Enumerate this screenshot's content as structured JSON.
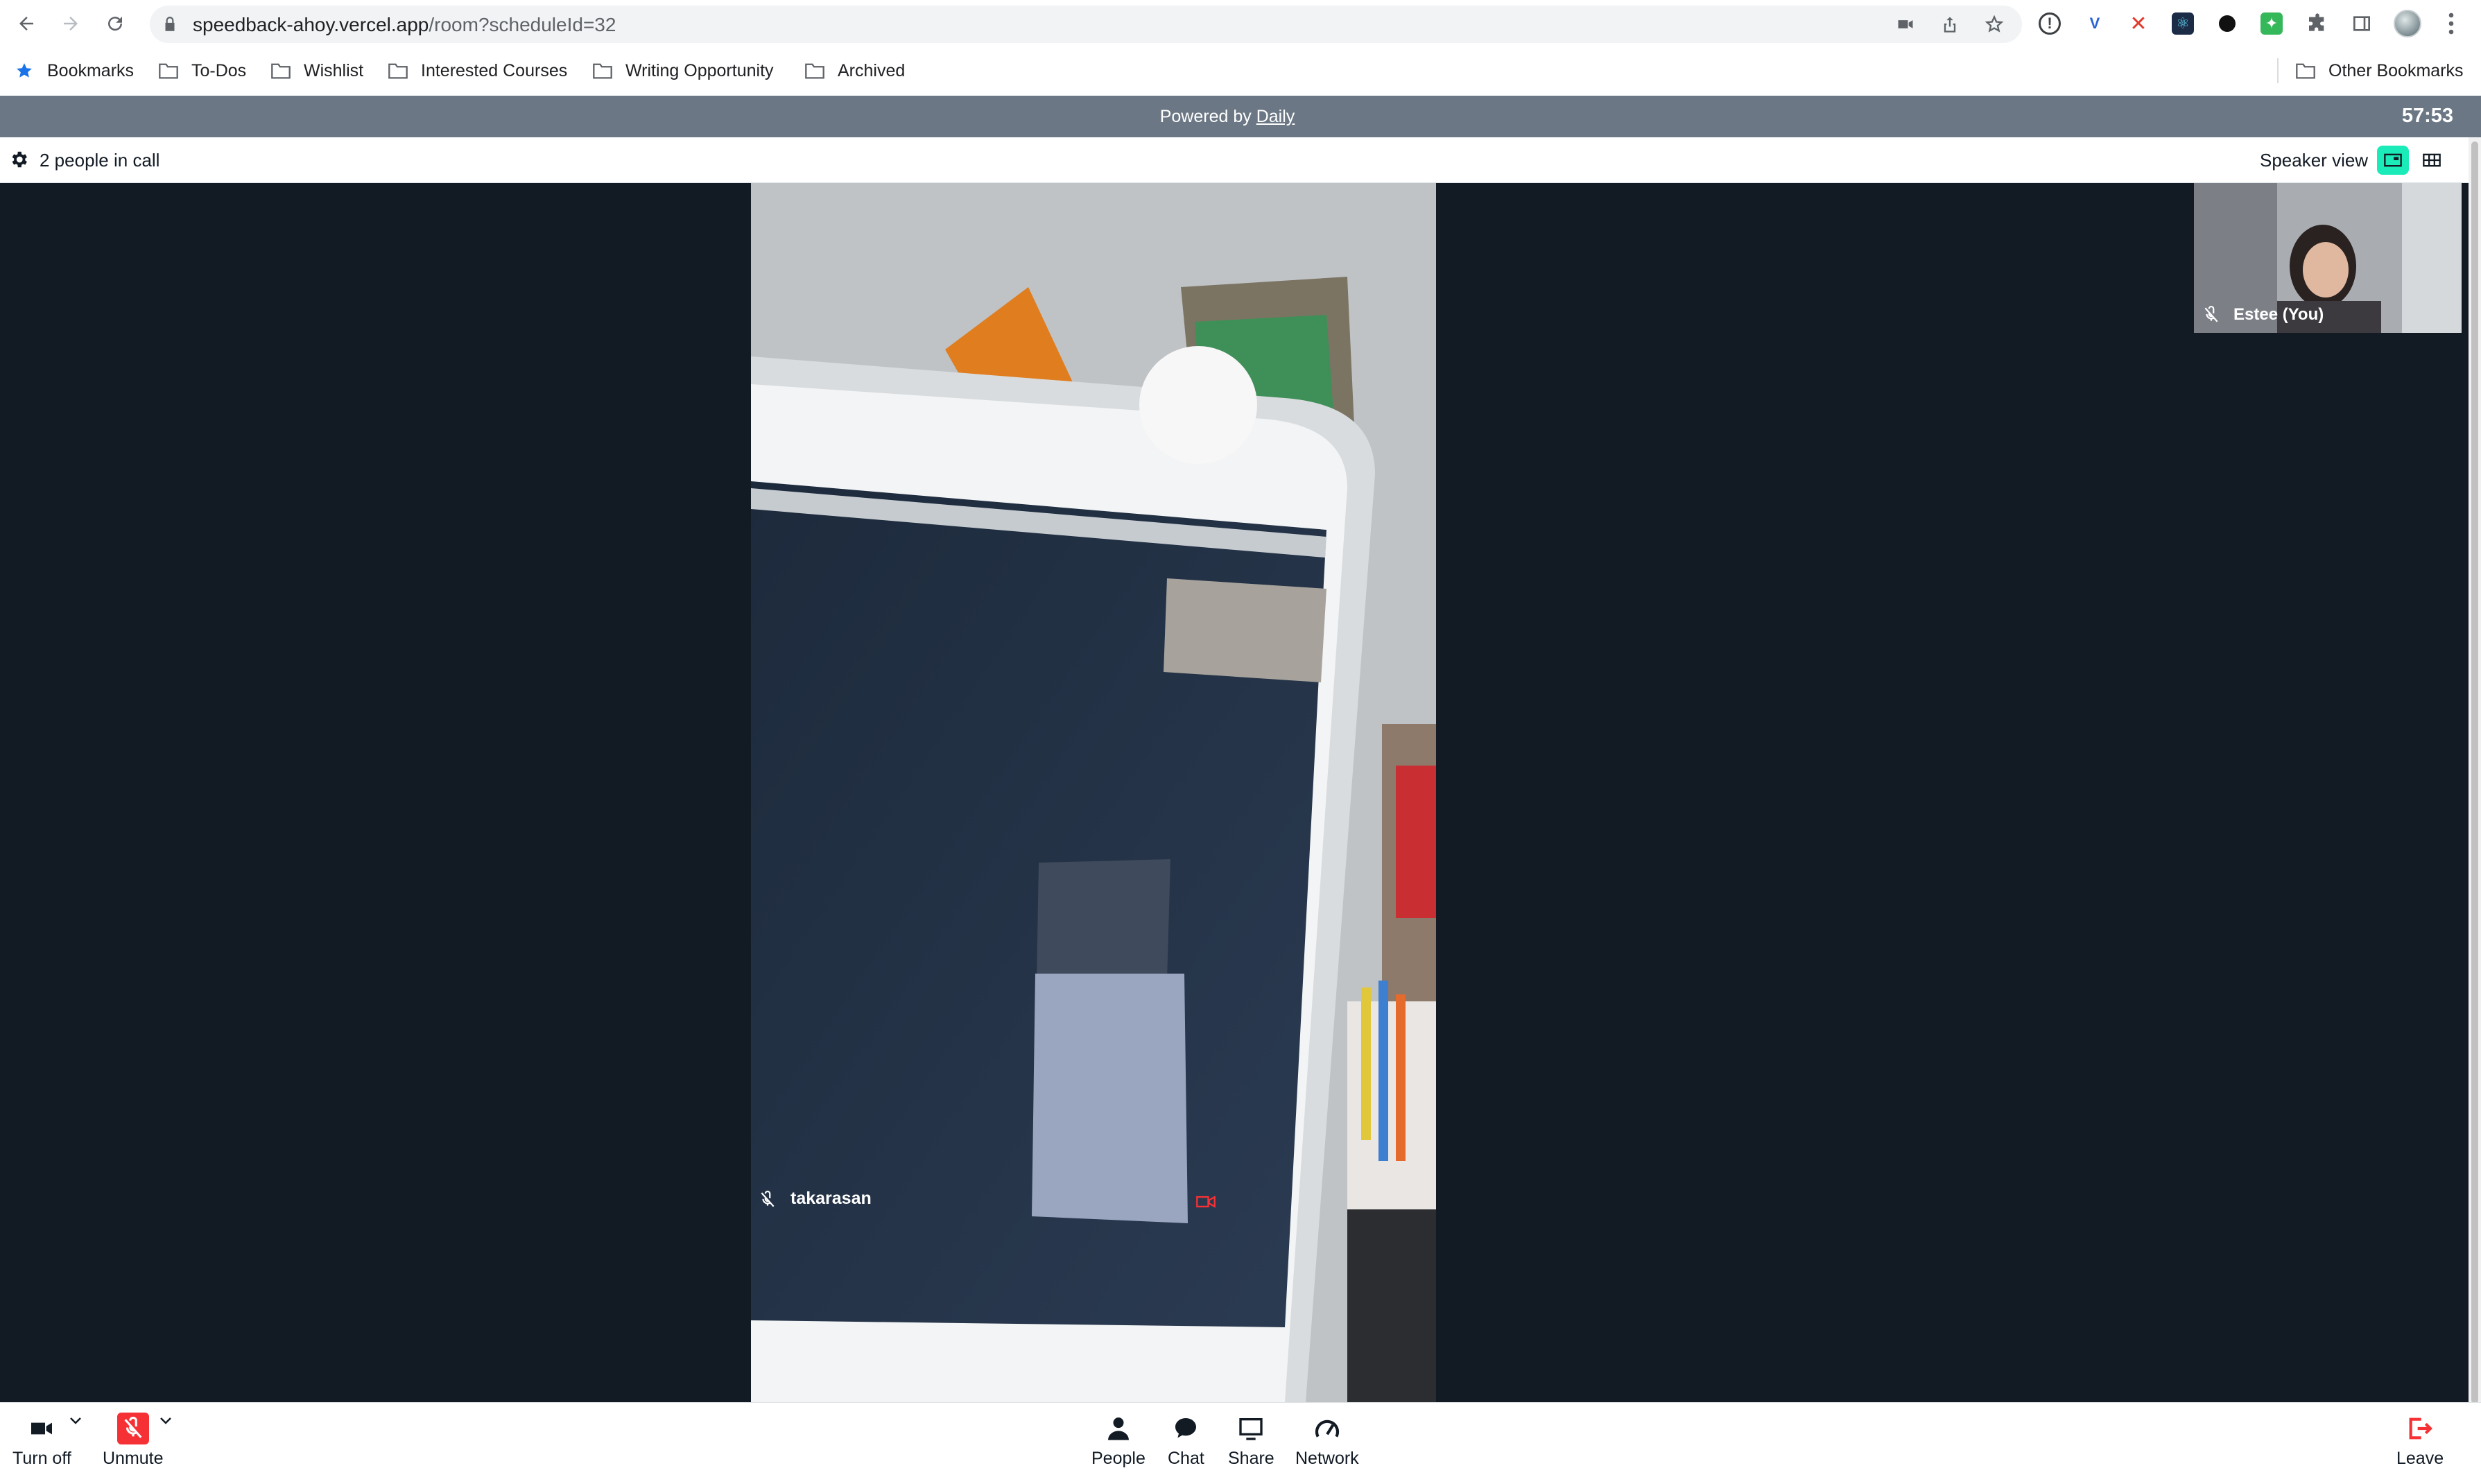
{
  "browser": {
    "url_host": "speedback-ahoy.vercel.app",
    "url_path": "/room?scheduleId=32",
    "icons": [
      "back-icon",
      "forward-icon",
      "reload-icon",
      "lock-icon",
      "camera-in-use-icon",
      "share-icon",
      "bookmark-star-icon",
      "extensions-icon",
      "side-panel-icon",
      "profile-avatar",
      "more-menu-icon"
    ]
  },
  "bookmarks": {
    "items": [
      "Bookmarks",
      "To-Dos",
      "Wishlist",
      "Interested Courses",
      "Writing Opportunity",
      "Archived"
    ],
    "other": "Other Bookmarks"
  },
  "call": {
    "powered_prefix": "Powered by ",
    "powered_link": "Daily",
    "timer": "57:53",
    "people_count": "2 people in call",
    "view_label": "Speaker view",
    "active_view": "speaker",
    "main_participant": "takarasan",
    "self_participant": "Estee (You)",
    "accent_color": "#1bebb9",
    "stage_color": "#121a24",
    "mic_off_color": "#f63135"
  },
  "tray": {
    "camera_label": "Turn off",
    "mic_label": "Unmute",
    "people_label": "People",
    "chat_label": "Chat",
    "share_label": "Share",
    "network_label": "Network",
    "leave_label": "Leave"
  }
}
